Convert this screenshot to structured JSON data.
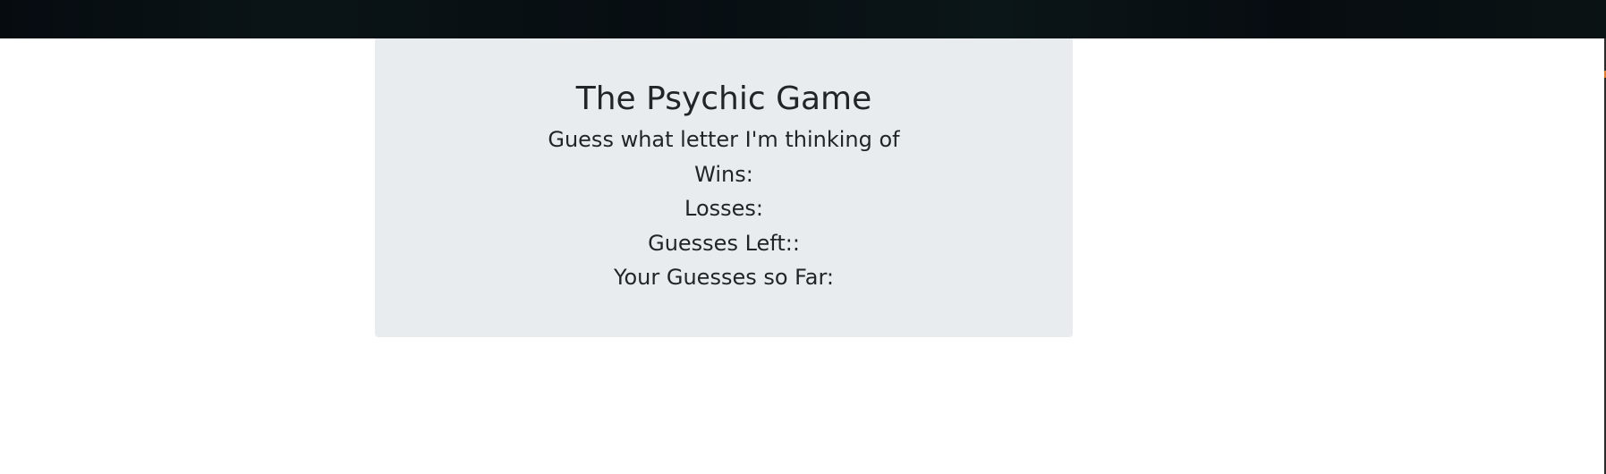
{
  "game": {
    "title": "The Psychic Game",
    "subtitle": "Guess what letter I'm thinking of",
    "wins_label": "Wins:",
    "losses_label": "Losses:",
    "guesses_left_label": "Guesses Left::",
    "guesses_so_far_label": "Your Guesses so Far:"
  },
  "colors": {
    "topbar": "#060b10",
    "panel": "#e9ecef",
    "text": "#212529"
  }
}
